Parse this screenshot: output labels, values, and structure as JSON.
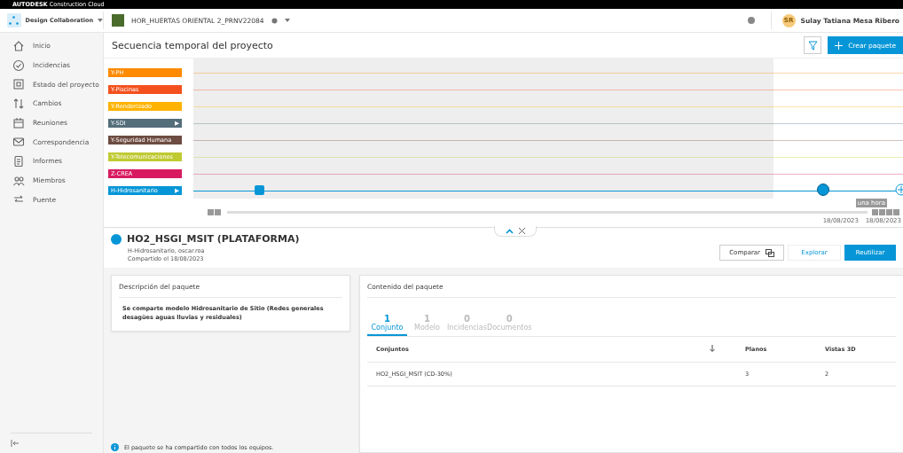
{
  "brand_bar": {
    "brand": "AUTODESK",
    "product": "Construction Cloud"
  },
  "header": {
    "module": "Design Collaboration",
    "project": "HOR_HUERTAS ORIENTAL 2_PRNV22084",
    "user_initials": "SR",
    "user_name": "Sulay Tatiana Mesa Ribero"
  },
  "sidebar": {
    "items": [
      {
        "label": "Inicio",
        "selected": false
      },
      {
        "label": "Incidencias",
        "selected": false
      },
      {
        "label": "Estado del proyecto",
        "selected": false
      },
      {
        "label": "Cambios",
        "selected": false
      },
      {
        "label": "Reuniones",
        "selected": false
      },
      {
        "label": "Correspondencia",
        "selected": false
      },
      {
        "label": "Informes",
        "selected": false
      },
      {
        "label": "Miembros",
        "selected": false
      },
      {
        "label": "Puente",
        "selected": false
      }
    ]
  },
  "page": {
    "title": "Secuencia temporal del proyecto",
    "create_button": "Crear paquete"
  },
  "timeline": {
    "lanes": [
      {
        "label": "Y-PH",
        "color": "#ff8a00",
        "selected": false
      },
      {
        "label": "Y-Piscinas",
        "color": "#f4511e",
        "selected": false
      },
      {
        "label": "Y-Renderizado",
        "color": "#ffb300",
        "selected": false
      },
      {
        "label": "Y-SDI",
        "color": "#546e7a",
        "arrow": "▶",
        "selected": false
      },
      {
        "label": "Y-Seguridad Humana",
        "color": "#6d4c41",
        "selected": false
      },
      {
        "label": "Y-Telecomunicaciones",
        "color": "#c0ca33",
        "selected": false
      },
      {
        "label": "Z-CREA",
        "color": "#d81b60",
        "selected": false
      },
      {
        "label": "H-Hidrosanitario",
        "color": "#0696d7",
        "arrow": "▶",
        "selected": true
      }
    ],
    "zoom_tooltip": "una hora",
    "start_date": "18/08/2023",
    "end_date": "18/08/2023"
  },
  "package": {
    "title": "HO2_HSGI_MSIT (PLATAFORMA)",
    "subtitle": "H-Hidrosanitario, oscar.roa",
    "shared": "Compartido el 18/08/2023",
    "buttons": [
      {
        "label": "Comparar",
        "kind": "outline"
      },
      {
        "label": "Explorar",
        "kind": "link"
      },
      {
        "label": "Reutilizar",
        "kind": "primary"
      }
    ],
    "description": {
      "heading": "Descripción del paquete",
      "text": "Se comparte modelo Hidrosanitario de Sitio (Redes generales desagües aguas lluvias y residuales)"
    },
    "info": "El paquete se ha compartido con todos los equipos.",
    "contents": {
      "heading": "Contenido del paquete",
      "tabs": [
        {
          "count": "1",
          "label": "Conjunto",
          "selected": true
        },
        {
          "count": "1",
          "label": "Modelo",
          "selected": false
        },
        {
          "count": "0",
          "label": "Incidencias",
          "selected": false
        },
        {
          "count": "0",
          "label": "Documentos",
          "selected": false
        }
      ],
      "table": {
        "columns": [
          "Conjuntos",
          "Planos",
          "Vistas 3D"
        ],
        "rows": [
          [
            "HO2_HSGI_MSIT (CD-30%)",
            "3",
            "2"
          ]
        ]
      }
    }
  }
}
